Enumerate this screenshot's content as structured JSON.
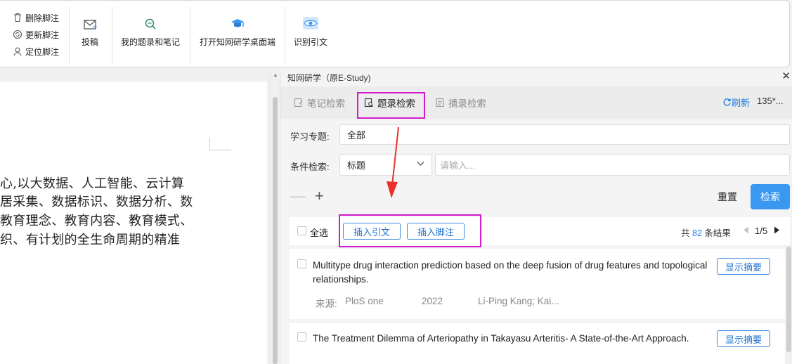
{
  "ribbon": {
    "small_buttons": [
      {
        "label": "删除脚注",
        "icon": "trash-icon"
      },
      {
        "label": "更新脚注",
        "icon": "refresh-circle-icon"
      },
      {
        "label": "定位脚注",
        "icon": "locate-icon"
      }
    ],
    "submit_label": "投稿",
    "my_records_label": "我的题录和笔记",
    "open_desktop_label": "打开知网研学桌面端",
    "identify_citation_label": "识别引文"
  },
  "document": {
    "lines": [
      "心,以大数据、人工智能、云计算",
      "居采集、数据标识、数据分析、数",
      "教育理念、教育内容、教育模式、",
      "织、有计划的全生命周期的精准"
    ]
  },
  "panel": {
    "title": "知网研学（原E-Study)",
    "close_glyph": "✕",
    "tabs": [
      {
        "label": "笔记检索",
        "icon": "note-search-icon",
        "active": false
      },
      {
        "label": "题录检索",
        "icon": "record-search-icon",
        "active": true
      },
      {
        "label": "摘录检索",
        "icon": "excerpt-search-icon",
        "active": false
      }
    ],
    "refresh_label": "刷新",
    "count_truncated": "135*...",
    "topic_label": "学习专题:",
    "topic_value": "全部",
    "condition_label": "条件检索:",
    "condition_field": "标题",
    "search_placeholder": "请输入...",
    "minus_glyph": "—",
    "plus_glyph": "+",
    "reset_label": "重置",
    "search_label": "检索",
    "select_all_label": "全选",
    "insert_citation_label": "插入引文",
    "insert_footnote_label": "插入脚注",
    "total_prefix": "共",
    "total_count": "82",
    "total_suffix": "条结果",
    "page_indicator": "1/5",
    "results": [
      {
        "title": "Multitype drug interaction prediction based on the deep fusion of drug features and topological relationships.",
        "abstract_label": "显示摘要",
        "source_label": "来源:",
        "source": "PloS one",
        "year": "2022",
        "authors": "Li-Ping Kang; Kai..."
      },
      {
        "title": "The Treatment Dilemma of Arteriopathy in Takayasu Arteritis- A State-of-the-Art Approach.",
        "abstract_label": "显示摘要"
      }
    ]
  },
  "colors": {
    "accent": "#3b98f0",
    "link": "#1f7be0",
    "highlight": "#d31ccd",
    "annotation_arrow": "#e8322b"
  }
}
